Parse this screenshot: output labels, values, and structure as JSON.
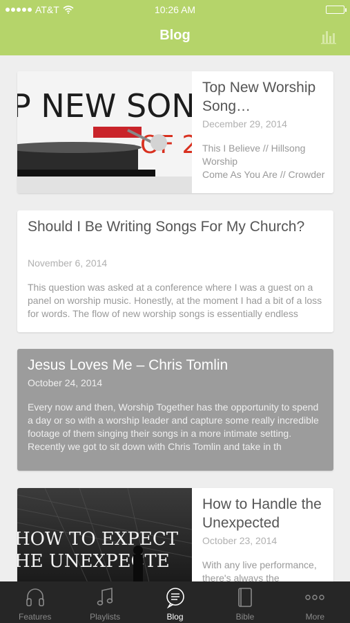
{
  "status_bar": {
    "carrier": "AT&T",
    "time": "10:26 AM"
  },
  "header": {
    "title": "Blog",
    "accent_color": "#b5d46a",
    "right_icon": "stats-icon"
  },
  "posts": [
    {
      "title": "Top New Worship Song…",
      "date": "December 29, 2014",
      "excerpt_line1": "This I Believe // Hillsong Worship",
      "excerpt_line2": "Come As You Are // Crowder",
      "image_text": "P NEW SONGS",
      "image_text2": "OF 2"
    },
    {
      "title": "Should I Be Writing Songs For My Church?",
      "date": "November 6, 2014",
      "excerpt": "This question was asked at a conference where I was a guest on a panel on worship music. Honestly, at the moment I had a bit of a loss for words. The flow of new worship songs is essentially endless"
    },
    {
      "title": "Jesus Loves Me – Chris Tomlin",
      "date": "October 24, 2014",
      "excerpt": "Every now and then, Worship Together has the opportunity to spend a day or so with a worship leader and capture some really incredible footage of them singing their songs in a more intimate setting. Recently we got to sit down with Chris Tomlin and take in th"
    },
    {
      "title": "How to Handle the Unexpected",
      "date": "October 23, 2014",
      "excerpt": "With any live performance, there's always the",
      "image_text": "HOW TO EXPECT",
      "image_text2": "HE UNEXPECTE"
    }
  ],
  "tabs": [
    {
      "label": "Features",
      "icon": "headphones-icon"
    },
    {
      "label": "Playlists",
      "icon": "music-note-icon"
    },
    {
      "label": "Blog",
      "icon": "chat-bubble-icon",
      "active": true
    },
    {
      "label": "Bible",
      "icon": "book-icon"
    },
    {
      "label": "More",
      "icon": "more-dots-icon"
    }
  ]
}
